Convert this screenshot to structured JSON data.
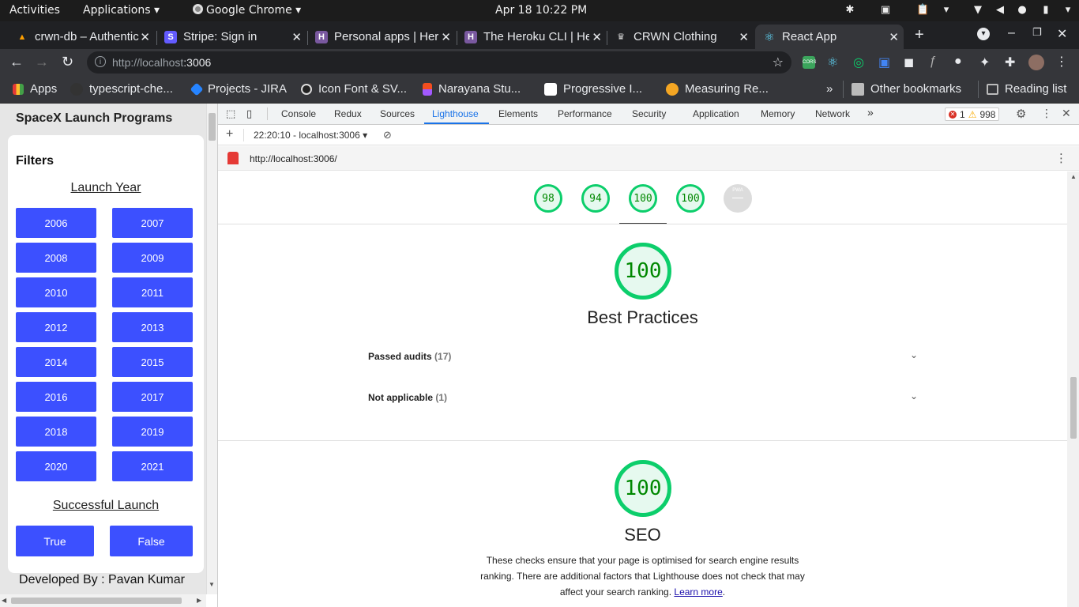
{
  "topbar": {
    "activities": "Activities",
    "applications": "Applications ▾",
    "app": "Google Chrome ▾",
    "datetime": "Apr 18  10:22 PM"
  },
  "tabs": [
    {
      "title": "crwn-db – Authentic",
      "fav_color": "#ffa000",
      "fav_char": "🔥"
    },
    {
      "title": "Stripe: Sign in",
      "fav_color": "#635bff",
      "fav_char": "S"
    },
    {
      "title": "Personal apps | Her",
      "fav_color": "#79589f",
      "fav_char": "H"
    },
    {
      "title": "The Heroku CLI | He",
      "fav_color": "#79589f",
      "fav_char": "H"
    },
    {
      "title": "CRWN Clothing",
      "fav_color": "#202124",
      "fav_char": "♛"
    },
    {
      "title": "React App",
      "fav_color": "#202124",
      "fav_char": "⚛"
    }
  ],
  "toolbar": {
    "url_host": "http://localhost",
    "url_port": ":3006"
  },
  "bookmarks": [
    {
      "label": "Apps",
      "color": "#e53935"
    },
    {
      "label": "typescript-che...",
      "color": "#333"
    },
    {
      "label": "Projects - JIRA",
      "color": "#2684ff"
    },
    {
      "label": "Icon Font & SV...",
      "color": "#222"
    },
    {
      "label": "Narayana Stu...",
      "color": "#a259ff"
    },
    {
      "label": "Progressive I...",
      "color": "#000"
    },
    {
      "label": "Measuring Re...",
      "color": "#f4a623"
    },
    {
      "label": "Other bookmarks",
      "color": "#bbb"
    },
    {
      "label": "Reading list",
      "color": "#bbb"
    }
  ],
  "page": {
    "title": "SpaceX Launch Programs",
    "filters_heading": "Filters",
    "launch_year_label": "Launch Year",
    "years": [
      "2006",
      "2007",
      "2008",
      "2009",
      "2010",
      "2011",
      "2012",
      "2013",
      "2014",
      "2015",
      "2016",
      "2017",
      "2018",
      "2019",
      "2020",
      "2021"
    ],
    "successful_launch_label": "Successful Launch",
    "true_label": "True",
    "false_label": "False",
    "footer": "Developed By : Pavan Kumar"
  },
  "devtools": {
    "tabs": [
      "Console",
      "Redux",
      "Sources",
      "Lighthouse",
      "Elements",
      "Performance",
      "Security",
      "Application",
      "Memory",
      "Network"
    ],
    "active_tab": "Lighthouse",
    "errors": "1",
    "warnings": "998",
    "report_selector": "22:20:10 - localhost:3006",
    "report_url": "http://localhost:3006/"
  },
  "report": {
    "scores": [
      "98",
      "94",
      "100",
      "100"
    ],
    "pwa_label": "PWA",
    "best_practices": {
      "score": "100",
      "title": "Best Practices",
      "passed_label": "Passed audits",
      "passed_count": "(17)",
      "na_label": "Not applicable",
      "na_count": "(1)"
    },
    "seo": {
      "score": "100",
      "title": "SEO",
      "description": "These checks ensure that your page is optimised for search engine results ranking. There are additional factors that Lighthouse does not check that may affect your search ranking.",
      "learn_more": "Learn more"
    }
  },
  "colors": {
    "accent_button": "#3c50ff",
    "pass_green": "#0cce6b",
    "devtools_active": "#1a73e8"
  }
}
